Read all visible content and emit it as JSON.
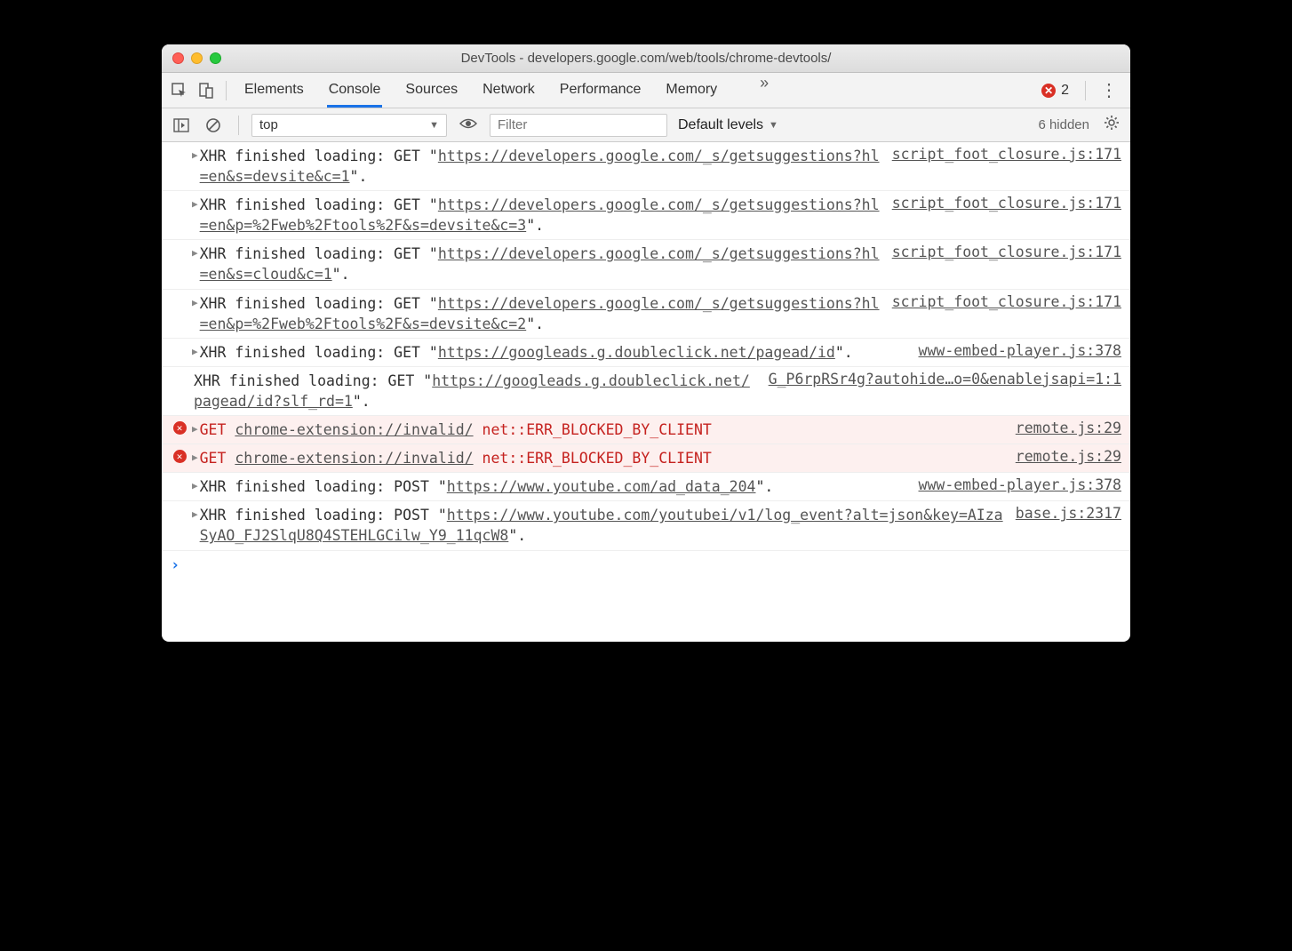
{
  "window": {
    "title": "DevTools - developers.google.com/web/tools/chrome-devtools/"
  },
  "tabs": {
    "items": [
      "Elements",
      "Console",
      "Sources",
      "Network",
      "Performance",
      "Memory"
    ],
    "active": "Console",
    "more_glyph": "»"
  },
  "error_badge": {
    "glyph": "✕",
    "count": "2"
  },
  "consolebar": {
    "context": "top",
    "filter_placeholder": "Filter",
    "levels": "Default levels",
    "hidden": "6 hidden"
  },
  "logs": [
    {
      "type": "xhr",
      "prefix": "XHR finished loading: GET \"",
      "url": "https://developers.google.com/_s/getsuggestions?hl=en&s=devsite&c=1",
      "suffix": "\".",
      "source": "script_foot_closure.js:171"
    },
    {
      "type": "xhr",
      "prefix": "XHR finished loading: GET \"",
      "url": "https://developers.google.com/_s/getsuggestions?hl=en&p=%2Fweb%2Ftools%2F&s=devsite&c=3",
      "suffix": "\".",
      "source": "script_foot_closure.js:171"
    },
    {
      "type": "xhr",
      "prefix": "XHR finished loading: GET \"",
      "url": "https://developers.google.com/_s/getsuggestions?hl=en&s=cloud&c=1",
      "suffix": "\".",
      "source": "script_foot_closure.js:171"
    },
    {
      "type": "xhr",
      "prefix": "XHR finished loading: GET \"",
      "url": "https://developers.google.com/_s/getsuggestions?hl=en&p=%2Fweb%2Ftools%2F&s=devsite&c=2",
      "suffix": "\".",
      "source": "script_foot_closure.js:171"
    },
    {
      "type": "xhr",
      "prefix": "XHR finished loading: GET \"",
      "url": "https://googleads.g.doubleclick.net/pagead/id",
      "suffix": "\".",
      "source": "www-embed-player.js:378"
    },
    {
      "type": "xhr-noexpand",
      "prefix": "XHR finished loading: GET \"",
      "url": "https://googleads.g.doubleclick.net/pagead/id?slf_rd=1",
      "suffix": "\".",
      "source": "G_P6rpRSr4g?autohide…o=0&enablejsapi=1:1"
    },
    {
      "type": "error",
      "method": "GET",
      "url": "chrome-extension://invalid/",
      "err": "net::ERR_BLOCKED_BY_CLIENT",
      "source": "remote.js:29"
    },
    {
      "type": "error",
      "method": "GET",
      "url": "chrome-extension://invalid/",
      "err": "net::ERR_BLOCKED_BY_CLIENT",
      "source": "remote.js:29"
    },
    {
      "type": "xhr",
      "prefix": "XHR finished loading: POST \"",
      "url": "https://www.youtube.com/ad_data_204",
      "suffix": "\".",
      "source": "www-embed-player.js:378"
    },
    {
      "type": "xhr",
      "prefix": "XHR finished loading: POST \"",
      "url": "https://www.youtube.com/youtubei/v1/log_event?alt=json&key=AIzaSyAO_FJ2SlqU8Q4STEHLGCilw_Y9_11qcW8",
      "suffix": "\".",
      "source": "base.js:2317"
    }
  ],
  "prompt_glyph": "›"
}
